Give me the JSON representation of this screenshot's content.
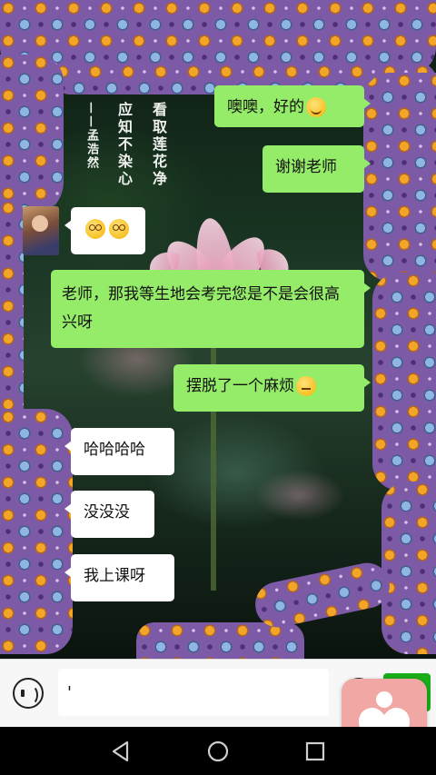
{
  "poem": {
    "col1": "看取莲花净",
    "col2": "应知不染心",
    "col3": "——孟浩然"
  },
  "messages": [
    {
      "side": "me",
      "text": "噢噢，好的",
      "emoji": "smile-emoji"
    },
    {
      "side": "me",
      "text": "谢谢老师"
    },
    {
      "side": "them",
      "text": "",
      "emoji": "dizzy-emoji"
    },
    {
      "side": "me",
      "text": "老师，那我等生地会考完您是不是会很高兴呀"
    },
    {
      "side": "me",
      "text": "摆脱了一个麻烦",
      "emoji": "thinking-emoji"
    },
    {
      "side": "them",
      "text": "哈哈哈哈"
    },
    {
      "side": "them",
      "text": "没没没"
    },
    {
      "side": "them",
      "text": "我上课呀"
    }
  ],
  "input": {
    "value": "'",
    "placeholder": ""
  },
  "icons": {
    "voice": "voice-icon",
    "emoji": "emoji-icon",
    "send": "send-button",
    "app": "heart-app-icon",
    "back": "back-icon",
    "home": "home-icon",
    "recents": "recents-icon"
  },
  "colors": {
    "my_bubble": "#95ec69",
    "their_bubble": "#ffffff",
    "border_purple": "#7c5aa6",
    "send_green": "#1aad19",
    "heart_app": "#f1a7a4"
  }
}
